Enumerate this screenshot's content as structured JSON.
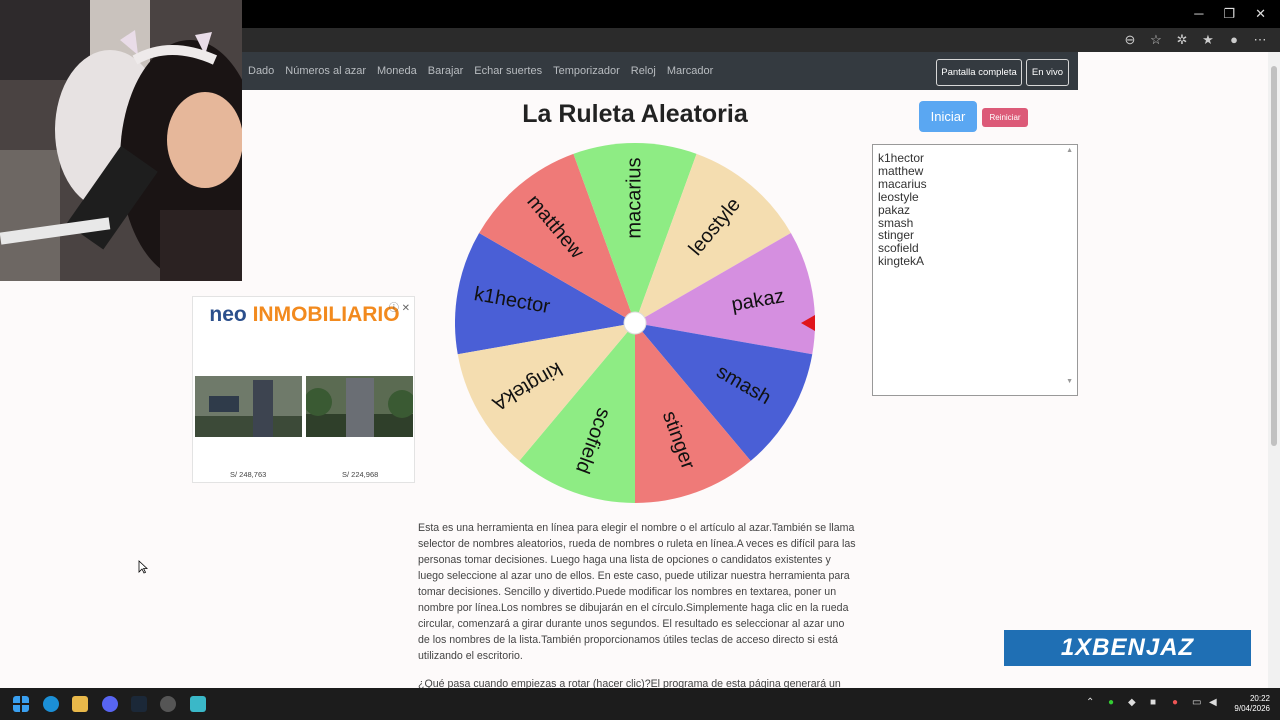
{
  "window": {
    "minimize": "─",
    "restore": "❐",
    "close": "✕"
  },
  "site": {
    "nav_links": [
      "Dado",
      "Números al azar",
      "Moneda",
      "Barajar",
      "Echar suertes",
      "Temporizador",
      "Reloj",
      "Marcador"
    ],
    "fullscreen_label": "Pantalla completa",
    "live_label": "En vivo"
  },
  "main": {
    "title": "La Ruleta Aleatoria",
    "start_label": "Iniciar",
    "reset_label": "Reiniciar",
    "names": [
      "k1hector",
      "matthew",
      "macarius",
      "leostyle",
      "pakaz",
      "smash",
      "stinger",
      "scofield",
      "kingtekA"
    ]
  },
  "wheel": {
    "segments": [
      {
        "name": "k1hector",
        "color": "#4a5fd6"
      },
      {
        "name": "matthew",
        "color": "#ef7a78"
      },
      {
        "name": "macarius",
        "color": "#8eec84"
      },
      {
        "name": "leostyle",
        "color": "#f4ddb0"
      },
      {
        "name": "pakaz",
        "color": "#d58fe0"
      },
      {
        "name": "smash",
        "color": "#4a5fd6"
      },
      {
        "name": "stinger",
        "color": "#ef7a78"
      },
      {
        "name": "scofield",
        "color": "#8eec84"
      },
      {
        "name": "kingtekA",
        "color": "#f4ddb0"
      }
    ],
    "pointer_color": "#e0151b"
  },
  "ad": {
    "brand_part1": "neo",
    "brand_part2": "INMOBILIARIO",
    "close": "ⓘ ✕",
    "prices": [
      "S/ 248,763",
      "S/ 224,968"
    ]
  },
  "description": {
    "paragraph1": "Esta es una herramienta en línea para elegir el nombre o el artículo al azar.También se llama selector de nombres aleatorios, rueda de nombres o ruleta en línea.A veces es difícil para las personas tomar decisiones. Luego haga una lista de opciones o candidatos existentes y luego seleccione al azar uno de ellos. En este caso, puede utilizar nuestra herramienta para tomar decisiones. Sencillo y divertido.Puede modificar los nombres en textarea, poner un nombre por línea.Los nombres se dibujarán en el círculo.Simplemente haga clic en la rueda circular, comenzará a girar durante unos segundos. El resultado es seleccionar al azar uno de los nombres de la lista.También proporcionamos útiles teclas de acceso directo si está utilizando el escritorio.",
    "paragraph2": "¿Qué pasa cuando empiezas a rotar (hacer clic)?El programa de esta página generará un"
  },
  "overlay": {
    "banner": "1XBENJAZ"
  },
  "taskbar": {
    "time": "20:22",
    "date": "9/04/2026"
  }
}
